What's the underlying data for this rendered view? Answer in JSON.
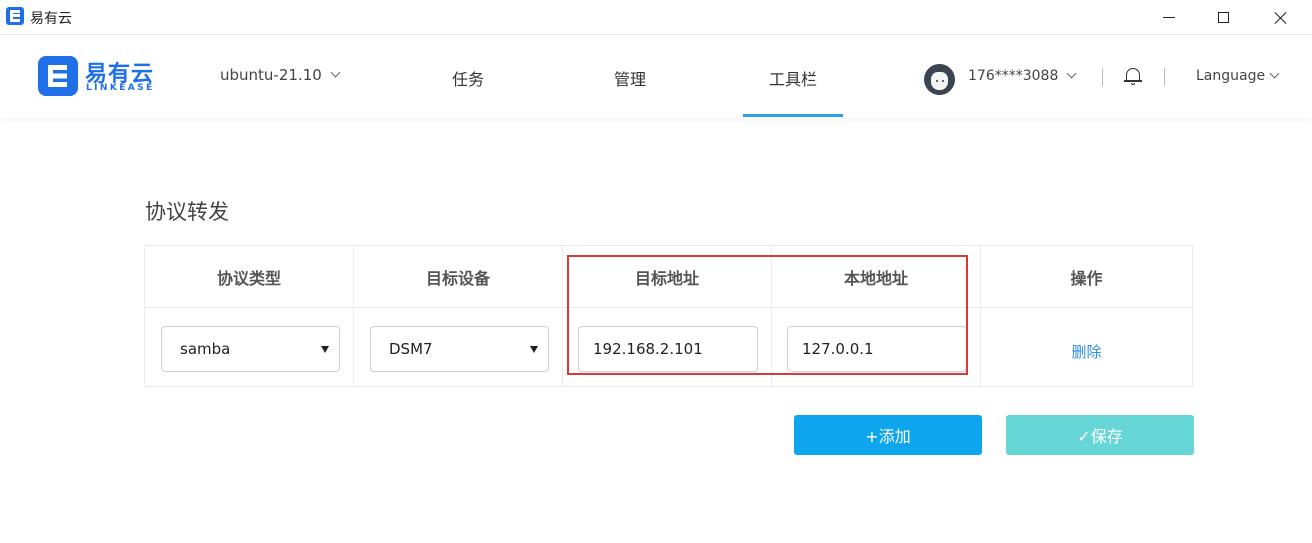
{
  "window": {
    "title": "易有云"
  },
  "header": {
    "logo_text": "易有云",
    "logo_sub": "LINKEASE",
    "device": "ubuntu-21.10",
    "tabs": [
      {
        "label": "任务"
      },
      {
        "label": "管理"
      },
      {
        "label": "工具栏",
        "active": true
      }
    ],
    "user": "176****3088",
    "language": "Language"
  },
  "colors": {
    "brand": "#1e6fe8",
    "active_tab": "#29a0e6",
    "add_button": "#0ea5ef",
    "save_button": "#66d6d6",
    "link": "#2c8fe6",
    "highlight": "#d83a3a"
  },
  "icons": [
    "chevron-down-icon",
    "avatar",
    "bell-icon",
    "minimize-icon",
    "maximize-icon",
    "close-icon"
  ],
  "main": {
    "section_title": "协议转发",
    "table": {
      "headers": [
        "协议类型",
        "目标设备",
        "目标地址",
        "本地地址",
        "操作"
      ],
      "rows": [
        {
          "protocol": "samba",
          "device": "DSM7",
          "target_address": "192.168.2.101",
          "local_address": "127.0.0.1",
          "action": "删除"
        }
      ]
    },
    "buttons": {
      "add": "+添加",
      "save": "✓保存"
    }
  }
}
